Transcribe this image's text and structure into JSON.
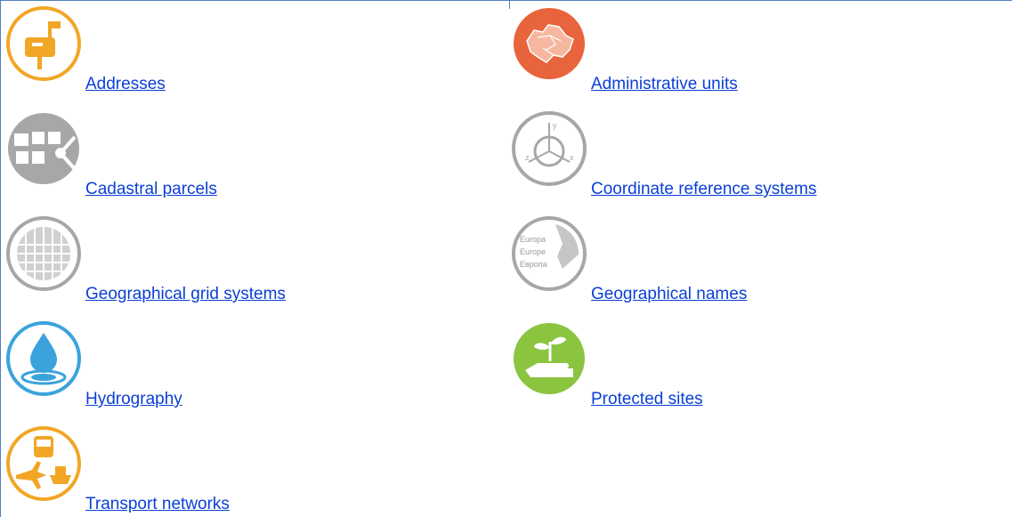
{
  "themes": [
    {
      "label": "Addresses",
      "icon": "mailbox-icon",
      "color": "#f2a626"
    },
    {
      "label": "Administrative units",
      "icon": "europe-map-icon",
      "color": "#e8643c"
    },
    {
      "label": "Cadastral parcels",
      "icon": "parcels-icon",
      "color": "#a7a7a7"
    },
    {
      "label": "Coordinate reference systems",
      "icon": "axes-globe-icon",
      "color": "#a7a7a7"
    },
    {
      "label": "Geographical grid systems",
      "icon": "grid-globe-icon",
      "color": "#a7a7a7"
    },
    {
      "label": "Geographical names",
      "icon": "names-globe-icon",
      "color": "#a7a7a7",
      "icon_text": [
        "Europa",
        "Europe",
        "Европа"
      ]
    },
    {
      "label": "Hydrography",
      "icon": "water-drop-icon",
      "color": "#3aa3dc"
    },
    {
      "label": "Protected sites",
      "icon": "plant-hand-icon",
      "color": "#8bc43f"
    },
    {
      "label": "Transport networks",
      "icon": "transport-icon",
      "color": "#f2a626"
    }
  ]
}
